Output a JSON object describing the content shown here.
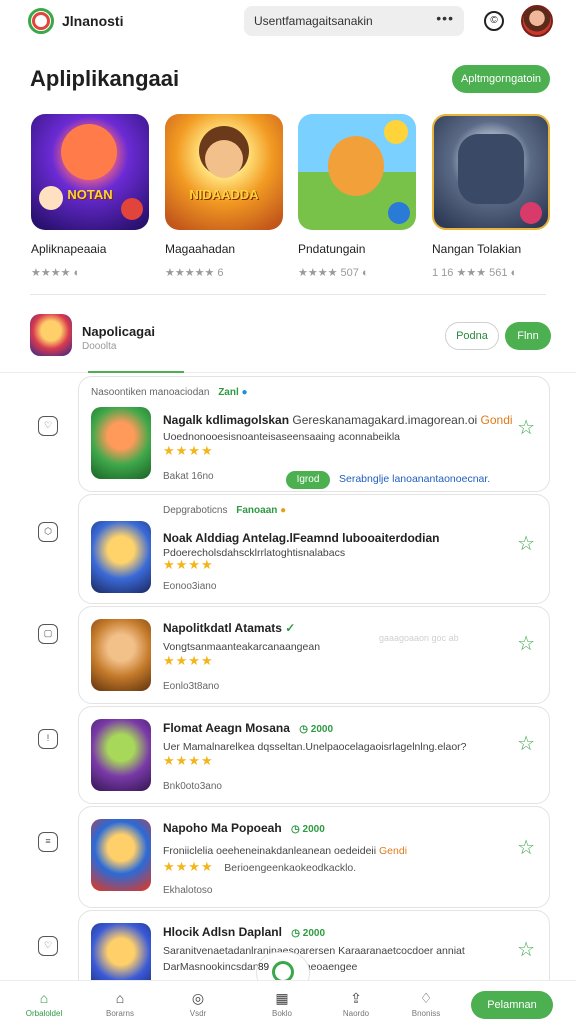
{
  "topbar": {
    "app_name": "Jlnanosti",
    "search_text": "Usentfamagaitsanakin",
    "more_label": "•••",
    "clock_label": "©"
  },
  "featured": {
    "title": "Apliplikangaai",
    "action_label": "Apltmgorngatoin",
    "cards": [
      {
        "name": "Apliknapeaaia",
        "rating": "★★★★ ◐",
        "tag": "NOTAN"
      },
      {
        "name": "Magaahadan",
        "rating": "★★★★★ 6",
        "tag": "NIDAADDA"
      },
      {
        "name": "Pndatungain",
        "rating": "★★★★ 507 ◐",
        "tag": ""
      },
      {
        "name": "Nangan Tolakian",
        "rating": "1 16 ★★★ 561 ◐",
        "tag": ""
      }
    ]
  },
  "section2": {
    "title": "Napolicagai",
    "subtitle": "Dooolta",
    "btn_outline": "Podna",
    "btn_green": "Flnn"
  },
  "list": {
    "header": "Nasoontiken manoaciodan",
    "header_badge": "Zanl",
    "items": [
      {
        "title": "Nagalk kdlimagolskan",
        "title_extra": "Gereskanamagakard.imagorean.oi",
        "title_hl": "Gondi",
        "desc": "Uoednonooesisnoanteisaseensaaing aconnabeikla",
        "stars": "★★★★",
        "meta": "Bakat 16no",
        "pill": "Igrod",
        "link": "Serabnglje lanoanantaonoecnar."
      },
      {
        "top": "Depgraboticns",
        "top_badge": "Fanoaan",
        "title": "Noak Alddiag Antelag.lFeamnd lubooaiterdodian",
        "desc": "Pdoerecholsdahscklrrlatoghtisnalabacs",
        "stars": "★★★★",
        "meta": "Eonoo3iano"
      },
      {
        "title": "Napolitkdatl Atamats",
        "desc": "Vongtsanmaanteakarcanaangean",
        "stars": "★★★★",
        "meta": "Eonlo3t8ano",
        "faint": "gaaagoaaon goc ab"
      },
      {
        "title": "Flomat Aeagn Mosana",
        "badge": "◷ 2000",
        "desc": "Uer Mamalnarelkea dqsseltan.Unelpaocelagaoisrlagelnlng.elaor?",
        "stars": "★★★★",
        "meta": "Bnk0oto3ano"
      },
      {
        "title": "Napoho Ma Popoeah",
        "badge": "◷ 2000",
        "desc": "Froniiclelia oeeheneinakdanleanean oedeideii",
        "desc_hl": "Gendi",
        "stars": "★★★★",
        "stars_extra": "Berioengeenkaokeodkacklo.",
        "meta": "Ekhalotoso"
      },
      {
        "title": "Hlocik Adlsn Daplanl",
        "badge": "◷ 2000",
        "desc": "Saranitvenaetadanlraninaesoarersen Karaaranaetcocdoer anniat",
        "desc2": "DarMasnookincsdan iongenegaeoaengee",
        "stars": "",
        "meta": ""
      }
    ]
  },
  "bottom_nav": {
    "items": [
      {
        "label": "Orbaloldel"
      },
      {
        "label": "Borarns"
      },
      {
        "label": "Vsdr"
      },
      {
        "label": "Boklo"
      },
      {
        "label": "Naordo"
      },
      {
        "label": "Bnoniss"
      }
    ],
    "fab_label": "89",
    "cta": "Pelamnan"
  },
  "colors": {
    "accent": "#4caf50",
    "star": "#f3b51b",
    "link": "#1f5fbf"
  }
}
